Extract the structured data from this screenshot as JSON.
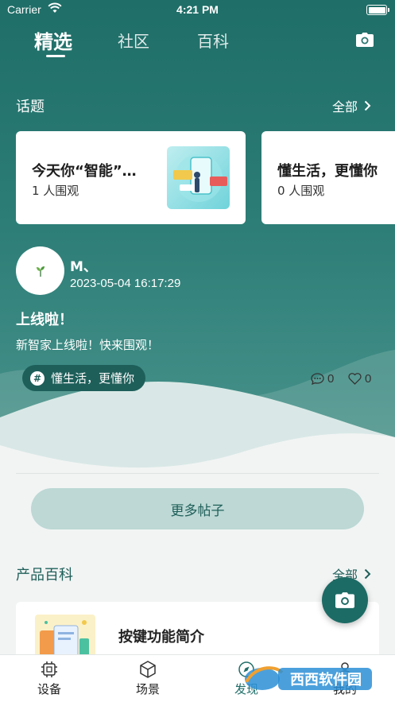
{
  "status_bar": {
    "carrier": "Carrier",
    "time": "4:21 PM"
  },
  "top_tabs": [
    {
      "label": "精选",
      "active": true
    },
    {
      "label": "社区",
      "active": false
    },
    {
      "label": "百科",
      "active": false
    }
  ],
  "topics": {
    "title": "话题",
    "all_label": "全部",
    "cards": [
      {
        "title": "今天你“智能”…",
        "watchers": "1 人围观"
      },
      {
        "title": "懂生活，更懂你",
        "watchers": "0 人围观"
      }
    ]
  },
  "post": {
    "user": "M、",
    "time": "2023-05-04 16:17:29",
    "title": "上线啦！",
    "body": "新智家上线啦！快来围观！",
    "tag": "懂生活，更懂你",
    "comments": "0",
    "likes": "0"
  },
  "more_posts_label": "更多帖子",
  "products": {
    "title": "产品百科",
    "all_label": "全部",
    "first_item": "按键功能简介"
  },
  "bottom_tabs": [
    {
      "label": "设备",
      "icon": "chip-icon"
    },
    {
      "label": "场景",
      "icon": "cube-icon"
    },
    {
      "label": "发现",
      "icon": "compass-icon"
    },
    {
      "label": "我的",
      "icon": "user-icon"
    }
  ],
  "watermark_text": "西西软件园",
  "colors": {
    "primary": "#1f6e68",
    "button_bg": "#bdd8d5",
    "tag_bg": "#1e5f5a"
  }
}
